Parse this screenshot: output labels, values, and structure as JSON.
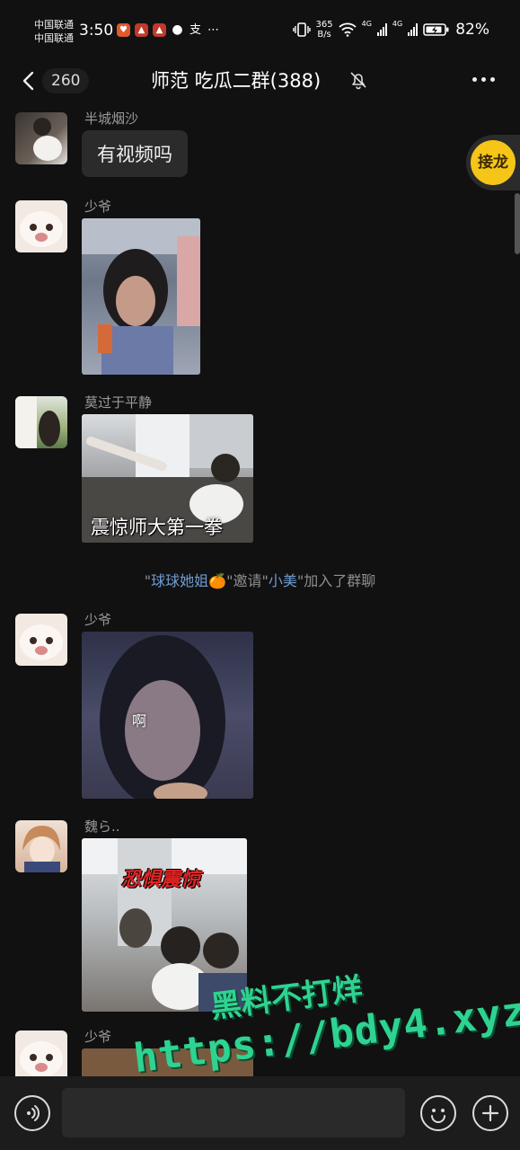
{
  "status_bar": {
    "carrier_1": "中国联通",
    "carrier_2": "中国联通",
    "time": "3:50",
    "net_speed_value": "365",
    "net_speed_unit": "B/s",
    "network_1": "4G",
    "network_2": "4G",
    "battery": "82%"
  },
  "header": {
    "unread_count": "260",
    "title": "师范 吃瓜二群(388)"
  },
  "floating": {
    "jielong_label": "接龙"
  },
  "messages": [
    {
      "sender": "半城烟沙",
      "text": "有视频吗"
    },
    {
      "sender": "少爷"
    },
    {
      "sender": "莫过于平静",
      "caption": "震惊师大第一拳"
    },
    {
      "sender": "少爷",
      "caption": "啊"
    },
    {
      "sender": "魏ら..",
      "caption": "恐惧震惊"
    },
    {
      "sender": "少爷"
    }
  ],
  "system_message": {
    "quote_open": "\"",
    "inviter": "球球她姐🍊",
    "middle": "\"邀请\"",
    "invitee": "小美",
    "end": "\"加入了群聊"
  },
  "watermark": {
    "line1": "黑料不打烊",
    "line2": "https://bdy4.xyz"
  },
  "input": {
    "placeholder": ""
  },
  "colors": {
    "background": "#111111",
    "bubble": "#2b2b2b",
    "accent_yellow": "#f5c518",
    "nickname_blue": "#6f9bd0",
    "watermark_green": "#2fd391"
  },
  "icons": [
    "back-icon",
    "mute-bell-icon",
    "more-icon",
    "voice-icon",
    "emoji-icon",
    "plus-icon"
  ]
}
